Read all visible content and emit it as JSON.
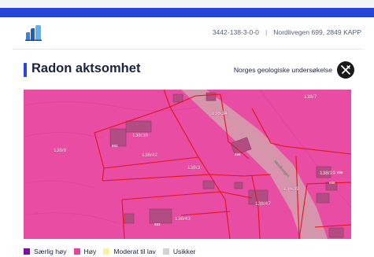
{
  "header": {
    "property_id": "3442-138-3-0-0",
    "address": "Nordlivegen 699, 2849 KAPP"
  },
  "section": {
    "title": "Radon aktsomhet",
    "source_label": "Norges geologiske undersøkelse"
  },
  "map": {
    "parcel_labels": [
      "138/7",
      "138/34",
      "138/8",
      "138/38",
      "138/42",
      "138/3",
      "138/47",
      "138/39",
      "138/43",
      "138/19"
    ],
    "building_numbers": [
      "693",
      "699",
      "663",
      "696",
      "698"
    ],
    "road_label": "Nordlivegen"
  },
  "legend": [
    {
      "label": "Særlig høy",
      "color": "#7d0da6"
    },
    {
      "label": "Høy",
      "color": "#e8449b"
    },
    {
      "label": "Moderat til lav",
      "color": "#f6f3a6"
    },
    {
      "label": "Usikker",
      "color": "#d3d3d3"
    }
  ]
}
